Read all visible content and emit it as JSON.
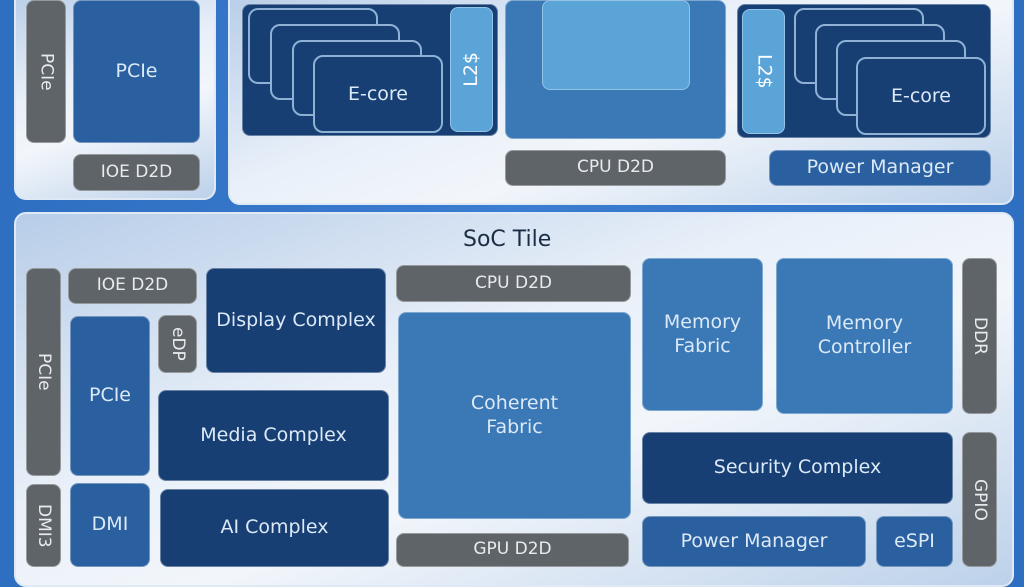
{
  "top_left": {
    "pcie_port": "PCIe",
    "pcie": "PCIe",
    "ioe_d2d": "IOE D2D"
  },
  "cpu_tile": {
    "ecore_left": "E-core",
    "l2_left": "L2$",
    "cpu_d2d": "CPU D2D",
    "l2_right": "L2$",
    "ecore_right": "E-core",
    "power_manager": "Power Manager"
  },
  "soc": {
    "title": "SoC Tile",
    "pcie_port": "PCIe",
    "dmi3": "DMI3",
    "ioe_d2d": "IOE D2D",
    "pcie": "PCIe",
    "dmi": "DMI",
    "edp": "eDP",
    "display": "Display Complex",
    "media": "Media Complex",
    "ai": "AI Complex",
    "cpu_d2d": "CPU D2D",
    "coherent": "Coherent Fabric",
    "gpu_d2d": "GPU D2D",
    "mem_fabric": "Memory Fabric",
    "mem_ctrl": "Memory Controller",
    "ddr": "DDR",
    "security": "Security Complex",
    "gpio": "GPIO",
    "power_manager": "Power Manager",
    "espi": "eSPI"
  },
  "colors": {
    "background": "#2f6fc2",
    "dark_block": "#173f73",
    "mid_block": "#2a609f",
    "light_block": "#5aa4d8",
    "io_block": "#5f6468"
  }
}
